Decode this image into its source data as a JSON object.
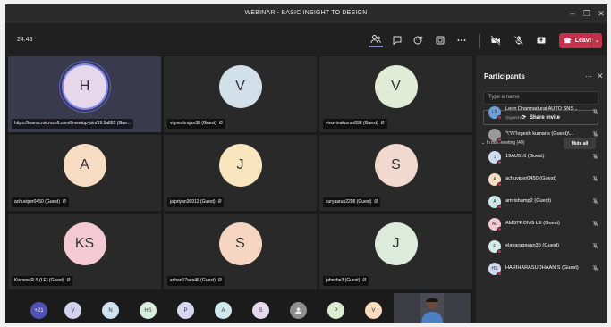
{
  "window": {
    "title": "WEBINAR - BASIC INSIGHT TO DESIGN"
  },
  "toolbar": {
    "timer": "24:43",
    "leave_label": "Leave"
  },
  "grid": {
    "tiles": [
      {
        "initials": "H",
        "name": "https://teams.microsoft.com/l/meetup-join/19:5a881 (Gue...",
        "color": "#e6d7ea",
        "speaking": true,
        "muted": false
      },
      {
        "initials": "V",
        "name": "vigneshrajan38 (Guest)",
        "color": "#d2e0ea",
        "muted": true
      },
      {
        "initials": "V",
        "name": "vinuvinukumar898 (Guest)",
        "color": "#e1ecd6",
        "muted": true
      },
      {
        "initials": "A",
        "name": "achuviper0450 (Guest)",
        "color": "#f6dcc3",
        "muted": true
      },
      {
        "initials": "J",
        "name": "jaipriyan36912 (Guest)",
        "color": "#f9e5be",
        "muted": true
      },
      {
        "initials": "S",
        "name": "suryaarun2206 (Guest)",
        "color": "#f2d9d0",
        "muted": true
      },
      {
        "initials": "KS",
        "name": "Kishore R S (LE) (Guest)",
        "color": "#f3c9d5",
        "muted": true
      },
      {
        "initials": "S",
        "name": "srihari17aes46 (Guest)",
        "color": "#f6d6c2",
        "muted": true
      },
      {
        "initials": "J",
        "name": "johncbe3 (Guest)",
        "color": "#dcebdc",
        "muted": true
      }
    ]
  },
  "overflow": {
    "more_count": "+21",
    "avatars": [
      {
        "initials": "V",
        "color": "#d2d2ee"
      },
      {
        "initials": "N",
        "color": "#cfe0ee"
      },
      {
        "initials": "HS",
        "color": "#d8eedd"
      },
      {
        "initials": "P",
        "color": "#dad8f0"
      },
      {
        "initials": "A",
        "color": "#cde7ea"
      },
      {
        "initials": "S",
        "color": "#e6d8ee"
      },
      {
        "initials": "",
        "color": "#8e8e8e"
      },
      {
        "initials": "P",
        "color": "#dcecd2"
      },
      {
        "initials": "V",
        "color": "#f6ddbf"
      }
    ]
  },
  "panel": {
    "title": "Participants",
    "search_placeholder": "Type a name",
    "share_label": "Share invite",
    "section_label": "In this meeting (40)",
    "mute_all_label": "Mute all",
    "participants": [
      {
        "initials": "LD",
        "name": "Leon Dharmadurai AUTO SNS...",
        "role": "Organizer",
        "color": "#6ea0d8"
      },
      {
        "initials": "",
        "name": "\"\\\"\\\\\\\"logesh kumar.s (Guest)\\...",
        "role": "",
        "color": "#9a9a9a"
      },
      {
        "initials": "1",
        "name": "19AU516 (Guest)",
        "role": "",
        "color": "#cfdcf0"
      },
      {
        "initials": "A",
        "name": "achuviper0450 (Guest)",
        "role": "",
        "color": "#f6dcc3"
      },
      {
        "initials": "A",
        "name": "amrishamp2 (Guest)",
        "role": "",
        "color": "#cde7ea"
      },
      {
        "initials": "AL",
        "name": "AMSTRONG LE (Guest)",
        "role": "",
        "color": "#f3c9d5"
      },
      {
        "initials": "E",
        "name": "elayaragavan35 (Guest)",
        "role": "",
        "color": "#d6ecea"
      },
      {
        "initials": "HS",
        "name": "HARIHARASUDHAAN S (Guest)",
        "role": "",
        "color": "#d2d6f0"
      }
    ]
  }
}
